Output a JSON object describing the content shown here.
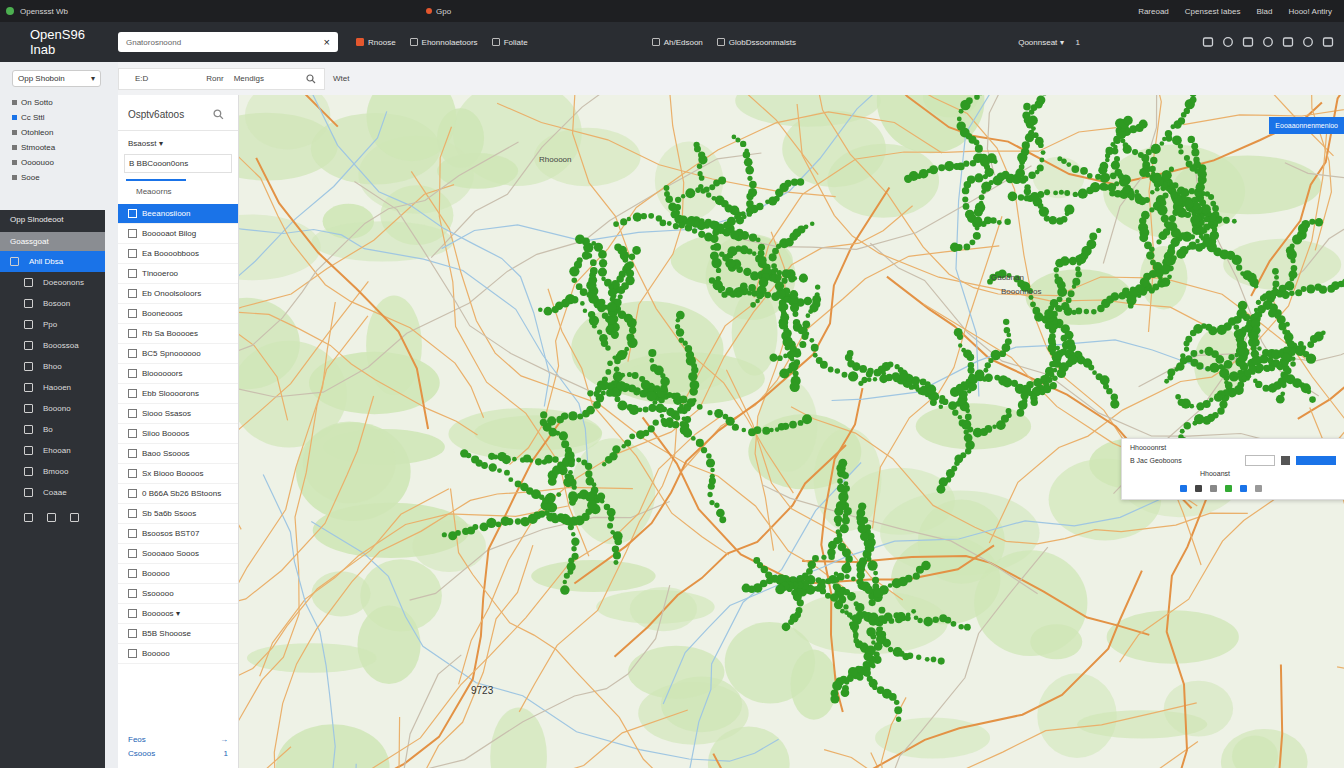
{
  "browser_bar": {
    "title": "Openssst Wb",
    "tab": "Gpo",
    "items": [
      "Rareoad",
      "Cpensest Iabes",
      "Blad",
      "Hooo! Antiry"
    ]
  },
  "header": {
    "logo": "OpenS96 Inab",
    "search": {
      "value": "Gnatorosnoond",
      "clear": "×"
    },
    "nav": [
      "Rnoose",
      "Ehonnolaetoors",
      "Foliate",
      "Ah/Edsoon",
      "GlobDssoonmalsts"
    ],
    "account": "Qoonnseat",
    "account_caret": "▾",
    "count": "1"
  },
  "toolbar": {
    "path": "E:D",
    "items": [
      "Ronr",
      "Mendigs"
    ],
    "extra": "Wtet"
  },
  "sidebar": {
    "dropdown": {
      "label": "Opp Shoboin",
      "caret": "▾"
    },
    "links": [
      "On Sotto",
      "Cc Sttl",
      "Otohleon",
      "Stmootea",
      "Oooouoo",
      "Sooe"
    ],
    "section": "Opp Slnodeoot",
    "group": "Goassgoat",
    "items": [
      {
        "label": "Ahll Dbsa",
        "selected": true
      },
      {
        "label": "Doeoonons",
        "selected": false
      },
      {
        "label": "Bosoon",
        "selected": false
      },
      {
        "label": "Ppo",
        "selected": false
      },
      {
        "label": "Booossoa",
        "selected": false
      },
      {
        "label": "Bhoo",
        "selected": false
      },
      {
        "label": "Haooen",
        "selected": false
      },
      {
        "label": "Booono",
        "selected": false
      },
      {
        "label": "Bo",
        "selected": false
      },
      {
        "label": "Ehooan",
        "selected": false
      },
      {
        "label": "Bmooo",
        "selected": false
      },
      {
        "label": "Coaae",
        "selected": false
      }
    ]
  },
  "panel": {
    "title": "Osptv6atoos",
    "menu": "Bsaosst ▾",
    "field": "B BBCooon0ons",
    "tab": "Meaoorns",
    "rows": [
      {
        "label": "Beeanosiioon",
        "selected": true
      },
      {
        "label": "Booooaot Bilog",
        "selected": false
      },
      {
        "label": "Ea Boooobboos",
        "selected": false
      },
      {
        "label": "Tlnooeroo",
        "selected": false
      },
      {
        "label": "Eb Onoolsoloors",
        "selected": false
      },
      {
        "label": "Booneooos",
        "selected": false
      },
      {
        "label": "Rb Sa Booooes",
        "selected": false
      },
      {
        "label": "BC5 Spnoooooo",
        "selected": false
      },
      {
        "label": "Bloooooors",
        "selected": false
      },
      {
        "label": "Ebb Sloooorons",
        "selected": false
      },
      {
        "label": "Siooo Ssasos",
        "selected": false
      },
      {
        "label": "Siioo Boooos",
        "selected": false
      },
      {
        "label": "Baoo Ssooos",
        "selected": false
      },
      {
        "label": "Sx Biooo Boooos",
        "selected": false
      },
      {
        "label": "0 B66A Sb26 BStoons",
        "selected": false
      },
      {
        "label": "Sb 5a6b Ssoos",
        "selected": false
      },
      {
        "label": "Bsoosos BST07",
        "selected": false
      },
      {
        "label": "Soooaoo Sooos",
        "selected": false
      },
      {
        "label": "Booooo",
        "selected": false
      },
      {
        "label": "Ssooooo",
        "selected": false
      },
      {
        "label": "Booooos ▾",
        "selected": false
      },
      {
        "label": "B5B Shooose",
        "selected": false
      },
      {
        "label": "Booooo",
        "selected": false
      }
    ],
    "footer": [
      {
        "label": "Feos",
        "mark": "→"
      },
      {
        "label": "Csooos",
        "mark": "1"
      }
    ]
  },
  "map": {
    "labels": [
      "Gaobnan",
      "Booonnoos",
      "Rhoooon"
    ],
    "scale": "9723",
    "action": "Eooaaonnenmenioo",
    "popup": {
      "title": "Hhoooonrst",
      "value": "B Jac Geoboons",
      "caption": "Hhooanst"
    }
  }
}
